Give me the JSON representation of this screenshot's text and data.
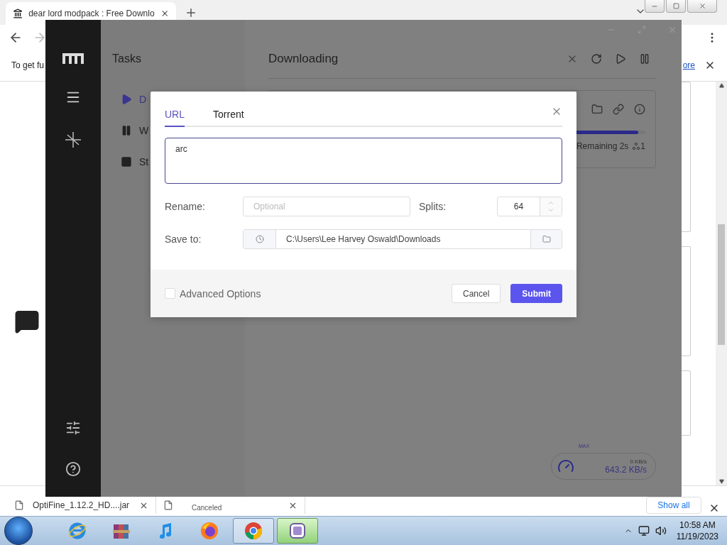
{
  "browser": {
    "tab_title": "dear lord modpack : Free Downlo",
    "infobar_text": "To get fu",
    "infobar_link": "ore"
  },
  "downloads_shelf": {
    "items": [
      {
        "kind": "file",
        "name": "OptiFine_1.12.2_HD....jar"
      },
      {
        "kind": "status",
        "name": "Canceled"
      }
    ],
    "show_all": "Show all"
  },
  "app": {
    "nav_title": "Tasks",
    "nav_items": [
      {
        "label": "D",
        "kind": "play",
        "selected": true
      },
      {
        "label": "W",
        "kind": "pause",
        "selected": false
      },
      {
        "label": "St",
        "kind": "stop",
        "selected": false
      }
    ],
    "main_title": "Downloading",
    "task": {
      "remaining": "Remaining 2s",
      "connections": "1",
      "level": 0.98
    },
    "speed": {
      "label": "MAX",
      "upload": "0 KB/s",
      "download": "643.2 KB/s"
    }
  },
  "dialog": {
    "tabs": [
      {
        "label": "URL",
        "selected": true
      },
      {
        "label": "Torrent",
        "selected": false
      }
    ],
    "url": "arc",
    "rename_label": "Rename:",
    "rename_placeholder": "Optional",
    "splits_label": "Splits:",
    "splits": "64",
    "save_label": "Save to:",
    "save_path": "C:\\Users\\Lee Harvey Oswald\\Downloads",
    "advanced": {
      "label": "Advanced Options",
      "checked": false
    },
    "cancel": "Cancel",
    "submit": "Submit"
  },
  "taskbar": {
    "apps": [
      {
        "kind": "ie",
        "open": false,
        "selected": false
      },
      {
        "kind": "archive",
        "open": false,
        "selected": false
      },
      {
        "kind": "music",
        "open": false,
        "selected": false
      },
      {
        "kind": "firefox",
        "open": false,
        "selected": false
      },
      {
        "kind": "chrome",
        "open": true,
        "selected": false
      },
      {
        "kind": "motrix",
        "open": true,
        "selected": true
      }
    ],
    "time": "10:58 AM",
    "date": "11/19/2023"
  }
}
